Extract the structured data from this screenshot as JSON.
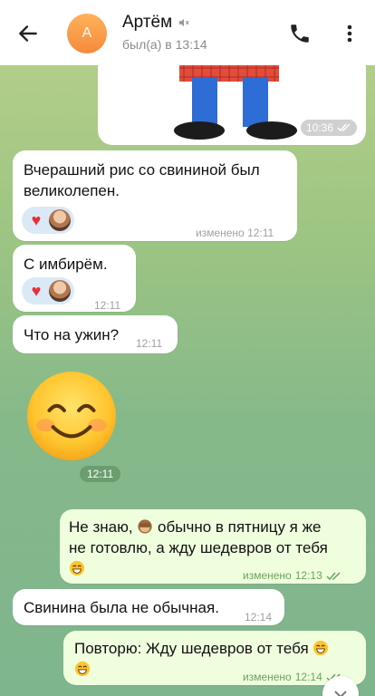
{
  "header": {
    "back_icon": "arrow-left-icon",
    "avatar_letter": "А",
    "name": "Артём",
    "muted_icon": "speaker-muted-icon",
    "status": "был(а) в 13:14",
    "call_icon": "phone-icon",
    "more_icon": "more-vertical-icon"
  },
  "colors": {
    "outgoing_bubble": "#efffde",
    "incoming_bubble": "#ffffff",
    "accent_orange": "#f58a3b",
    "read_check": "#6aa45a"
  },
  "messages": [
    {
      "type": "sticker",
      "direction": "out",
      "time": "10:36",
      "status_icon": "double-check-icon"
    },
    {
      "type": "text",
      "direction": "in",
      "text_line1": "Вчерашний рис со свининой был",
      "text_line2": "великолепен.",
      "edited_label": "изменено",
      "time": "12:11",
      "reactions": [
        "heart-icon",
        "user-avatar"
      ]
    },
    {
      "type": "text",
      "direction": "in",
      "text": "С имбирём.",
      "time": "12:11",
      "reactions": [
        "heart-icon",
        "user-avatar"
      ]
    },
    {
      "type": "text",
      "direction": "in",
      "text": "Что на ужин?",
      "time": "12:11"
    },
    {
      "type": "emoji",
      "direction": "in",
      "emoji_icon": "smiling-face-icon",
      "time": "12:11"
    },
    {
      "type": "text",
      "direction": "out",
      "text_line1a": "Не знаю,",
      "text_line1b": "обычно в пятницу я же",
      "text_line2": "не готовлю, а жду шедевров от тебя",
      "emoji1": "see-no-evil-monkey-icon",
      "emoji2": "grinning-face-icon",
      "edited_label": "изменено",
      "time": "12:13",
      "status_icon": "double-check-icon"
    },
    {
      "type": "text",
      "direction": "in",
      "text": "Свинина была не обычная.",
      "time": "12:14"
    },
    {
      "type": "text",
      "direction": "out",
      "text": "Повторю: Жду шедевров от тебя",
      "emoji": "grinning-face-icon",
      "edited_label": "изменено",
      "time": "12:14",
      "status_icon": "double-check-icon"
    }
  ],
  "scroll_down_icon": "chevron-down-icon"
}
